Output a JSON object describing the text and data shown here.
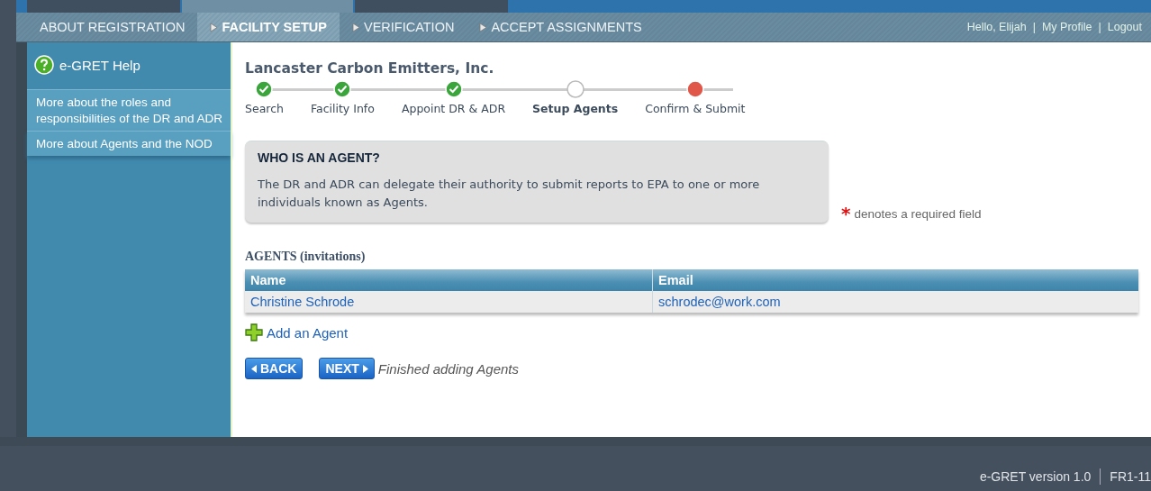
{
  "top_tabs": [
    {
      "selected": false
    },
    {
      "selected": true
    },
    {
      "selected": false
    }
  ],
  "nav": [
    {
      "label": "ABOUT REGISTRATION",
      "arrow": false,
      "selected": false
    },
    {
      "label": "FACILITY SETUP",
      "arrow": true,
      "selected": true
    },
    {
      "label": "VERIFICATION",
      "arrow": true,
      "selected": false
    },
    {
      "label": "ACCEPT ASSIGNMENTS",
      "arrow": true,
      "selected": false
    }
  ],
  "user_links": [
    "Hello, Elijah",
    "My Profile",
    "Logout"
  ],
  "user_separators": [
    "|",
    "|"
  ],
  "help": {
    "title": "e-GRET Help",
    "items": [
      "More about the roles and responsibilities of the DR and ADR",
      "More about Agents and the NOD"
    ]
  },
  "company": "Lancaster Carbon Emitters, Inc.",
  "steps": [
    {
      "label": "Search",
      "kind": "complete",
      "selected": false
    },
    {
      "label": "Facility Info",
      "kind": "complete",
      "selected": false
    },
    {
      "label": "Appoint DR & ADR",
      "kind": "complete",
      "selected": false
    },
    {
      "label": "Setup Agents",
      "kind": "current",
      "selected": true
    },
    {
      "label": "Confirm & Submit",
      "kind": "attention",
      "selected": false
    }
  ],
  "info_box": {
    "title": "WHO IS AN AGENT?",
    "text": "The DR and ADR can delegate their authority to submit reports to EPA to one or more individuals known as Agents."
  },
  "required_note": {
    "mark": "*",
    "text": "denotes a required field"
  },
  "agents": {
    "title": "AGENTS (invitations)",
    "columns": [
      "Name",
      "Email"
    ],
    "rows": [
      [
        "Christine Schrode",
        "schrodec@work.com"
      ]
    ]
  },
  "add_link": "Add an Agent",
  "back_button": "BACK",
  "next_button": "NEXT",
  "next_hint": "Finished adding Agents",
  "footer": [
    "e-GRET version 1.0",
    "FR1-11"
  ]
}
